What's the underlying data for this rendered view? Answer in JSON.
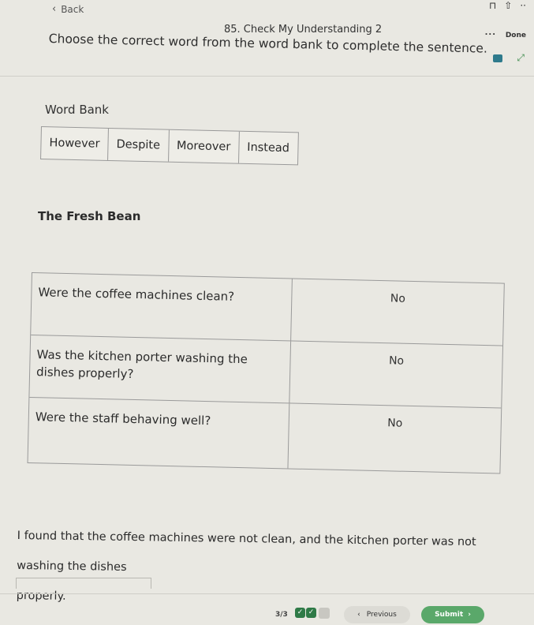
{
  "topbar": {
    "back_label": "Back",
    "question_title": "85. Check My Understanding 2",
    "instruction": "Choose the correct word from the word bank to complete the sentence.",
    "more_label": "...",
    "done_label": "Done"
  },
  "word_bank": {
    "label": "Word Bank",
    "words": [
      "However",
      "Despite",
      "Moreover",
      "Instead"
    ]
  },
  "passage": {
    "title": "The Fresh Bean",
    "rows": [
      {
        "question": "Were the coffee machines clean?",
        "answer": "No"
      },
      {
        "question": "Was the kitchen porter washing the dishes properly?",
        "answer": "No"
      },
      {
        "question": "Were the staff behaving well?",
        "answer": "No"
      }
    ],
    "sentence_line1": "I found that the coffee machines were not clean, and the kitchen porter was not washing the dishes",
    "sentence_line2": "properly."
  },
  "footer": {
    "progress": "3/3",
    "previous_label": "Previous",
    "submit_label": "Submit",
    "complete_color": "#2f7a47",
    "submit_color": "#5aa86a"
  }
}
